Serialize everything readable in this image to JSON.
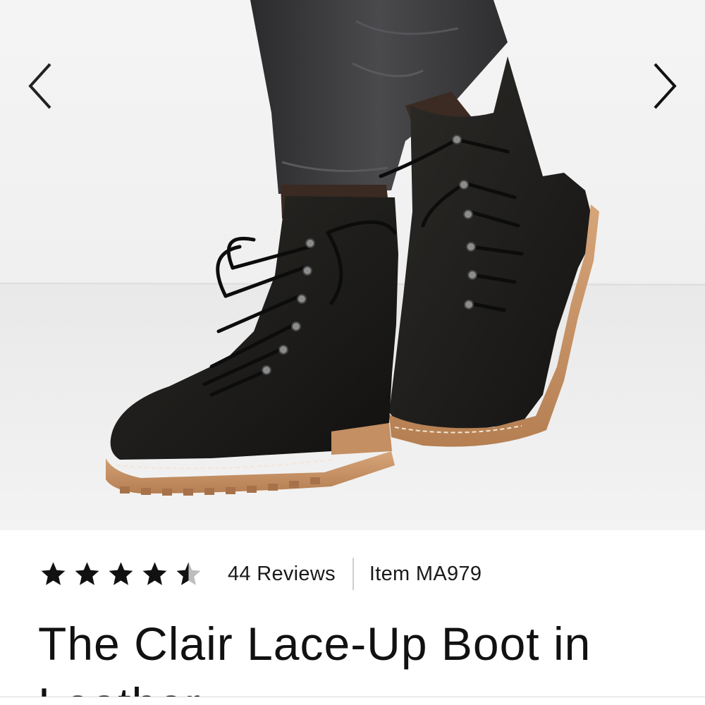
{
  "carousel": {
    "prev_icon": "chevron-left-icon",
    "next_icon": "chevron-right-icon",
    "image_alt": "Black leather lace-up boots with lug soles"
  },
  "product": {
    "rating": 4.5,
    "rating_max": 5,
    "reviews_label": "44 Reviews",
    "item_label": "Item MA979",
    "title": "The Clair Lace-Up Boot in Leather"
  },
  "colors": {
    "leather": "#1f1e1c",
    "sole": "#c48f62",
    "denim": "#3a3a3c",
    "background": "#f2f2f2"
  }
}
